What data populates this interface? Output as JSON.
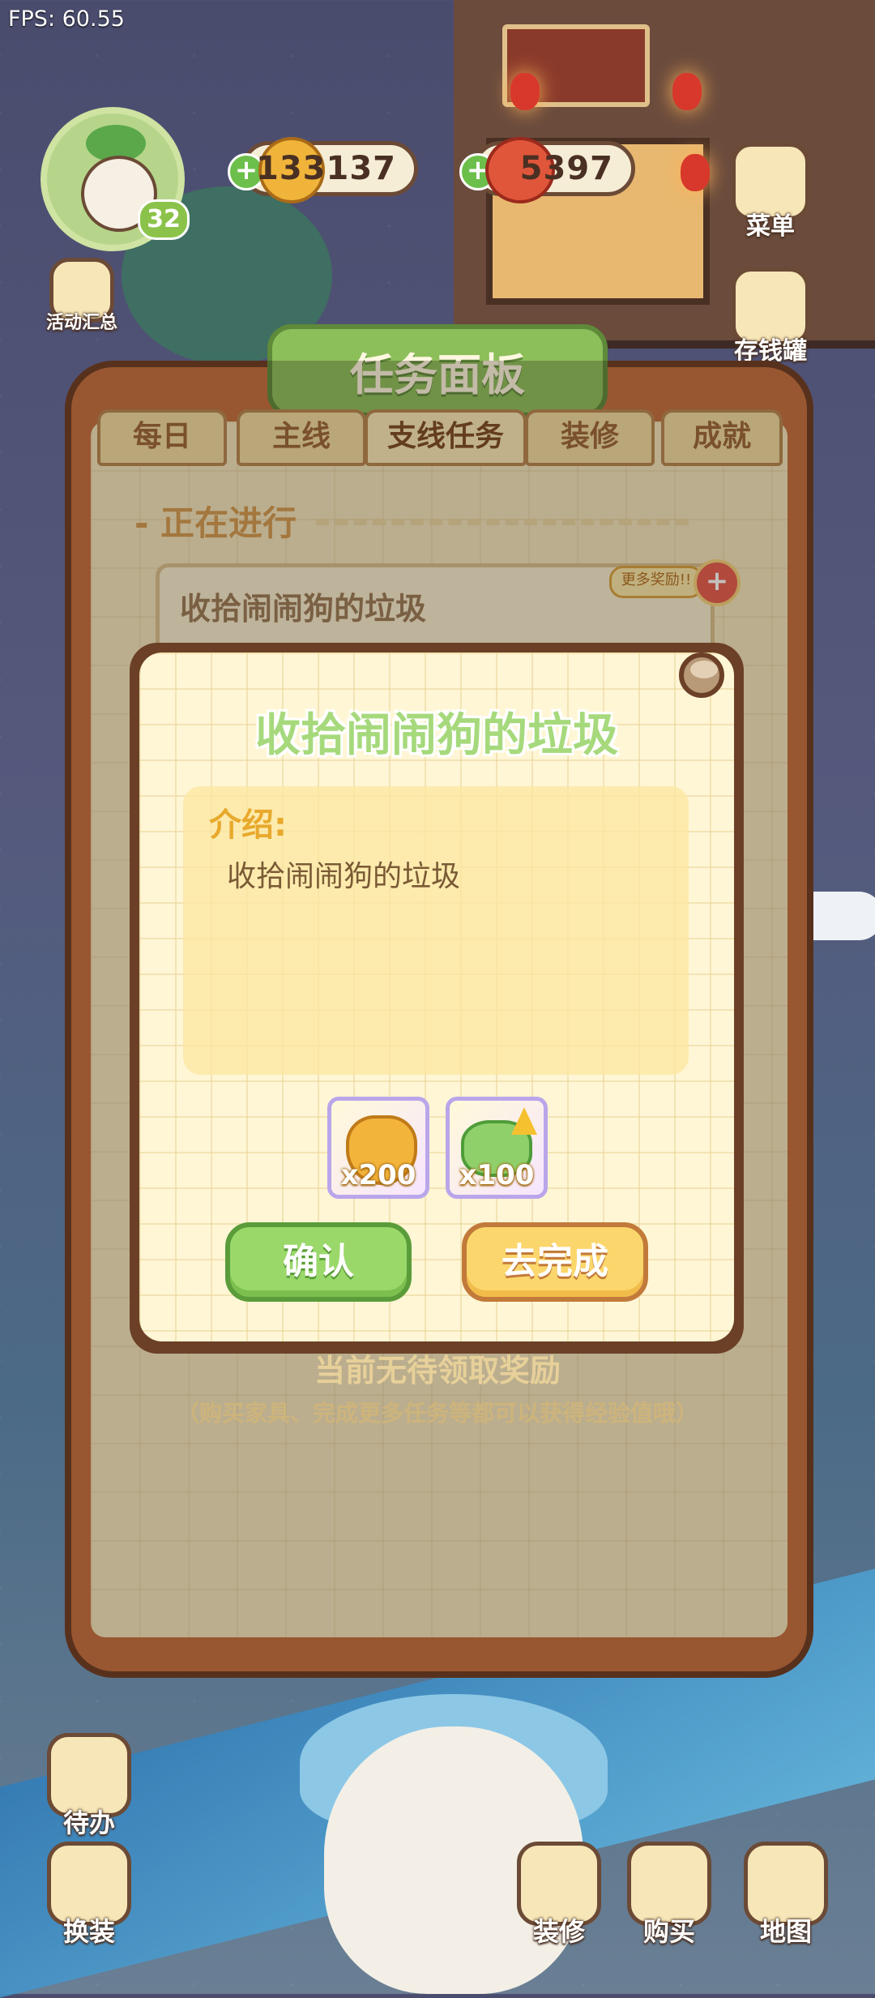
{
  "hud": {
    "fps": "FPS: 60.55",
    "level": "32",
    "coins": "133137",
    "tomatoes": "5397"
  },
  "right_buttons": [
    {
      "label": "菜单",
      "icon": "menu-book-icon"
    },
    {
      "label": "存钱罐",
      "icon": "piggy-bank-icon"
    }
  ],
  "left_buttons": [
    {
      "label": "活动汇总",
      "icon": "event-house-icon"
    }
  ],
  "panel": {
    "title": "任务面板",
    "tabs": [
      "每日",
      "主线",
      "支线任务",
      "装修",
      "成就"
    ],
    "active_tab": "支线任务",
    "section_label": "- 正在进行",
    "task_title": "收拾闹闹狗的垃圾",
    "more_rewards": "更多奖励!!",
    "bottom_note": "当前无待领取奖励",
    "bottom_hint": "（购买家具、完成更多任务等都可以获得经验值哦）"
  },
  "dialog": {
    "title": "收拾闹闹狗的垃圾",
    "intro_label": "介绍:",
    "intro_text": "收拾闹闹狗的垃圾",
    "rewards": [
      {
        "icon": "gold-pile-icon",
        "qty": "x200"
      },
      {
        "icon": "cash-upgrade-icon",
        "qty": "x100"
      }
    ],
    "confirm_label": "确认",
    "go_label": "去完成"
  },
  "bottom_bar": {
    "todo": "待办",
    "outfit": "换装",
    "decorate": "装修",
    "buy": "购买",
    "map": "地图"
  }
}
